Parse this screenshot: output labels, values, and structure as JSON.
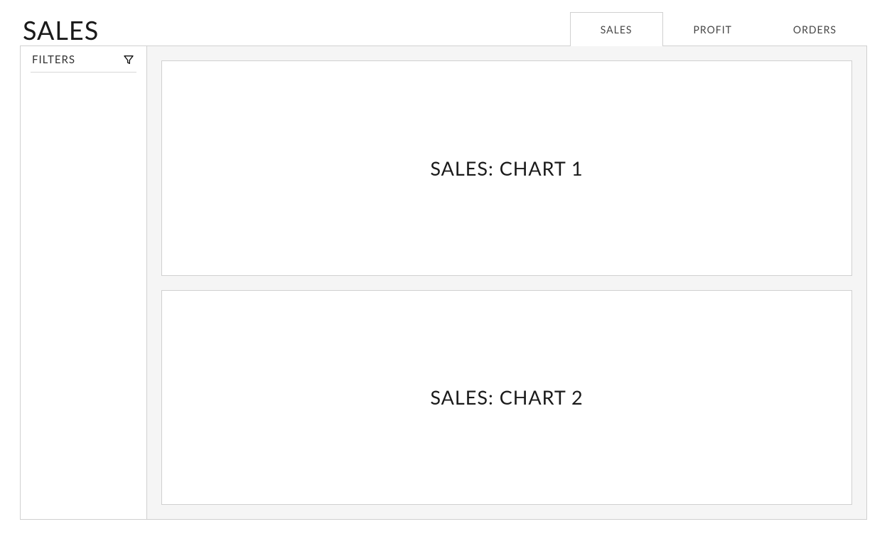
{
  "header": {
    "title": "SALES"
  },
  "tabs": [
    {
      "label": "SALES",
      "active": true
    },
    {
      "label": "PROFIT",
      "active": false
    },
    {
      "label": "ORDERS",
      "active": false
    }
  ],
  "sidebar": {
    "filters_label": "FILTERS"
  },
  "content": {
    "charts": [
      {
        "title": "SALES: CHART 1"
      },
      {
        "title": "SALES: CHART 2"
      }
    ]
  }
}
